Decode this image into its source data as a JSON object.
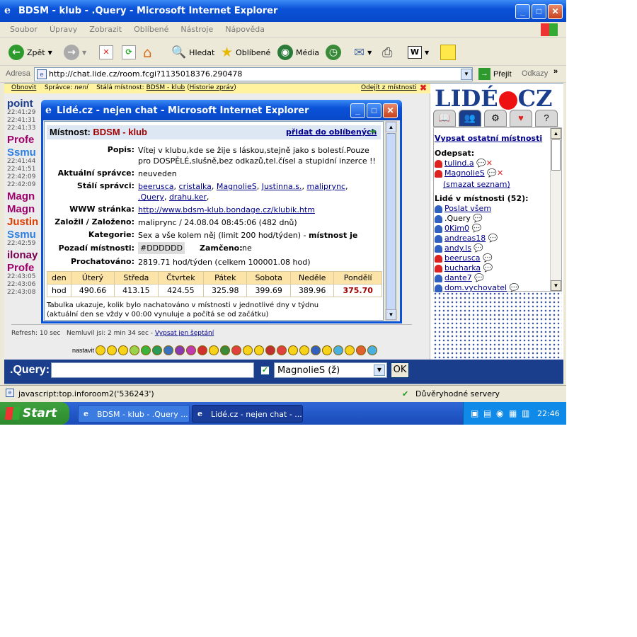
{
  "main_window": {
    "title": "BDSM - klub - .Query - Microsoft Internet Explorer",
    "menu": [
      "Soubor",
      "Úpravy",
      "Zobrazit",
      "Oblíbené",
      "Nástroje",
      "Nápověda"
    ],
    "toolbar": {
      "back": "Zpět",
      "search": "Hledat",
      "favorites": "Oblíbené",
      "media": "Média"
    },
    "address_label": "Adresa",
    "address_value": "http://chat.lide.cz/room.fcgi?1135018376.290478",
    "go_label": "Přejít",
    "links_label": "Odkazy"
  },
  "chat_toolbar": {
    "refresh": "Obnovit",
    "admin_label": "Správce:",
    "admin_value": "není",
    "permanent_label": "Stálá místnost:",
    "permanent_value": "BDSM - klub",
    "history": "Historie zpráv",
    "leave": "Odejít z místnosti"
  },
  "chat_lines": [
    {
      "nick": "point",
      "color": "#1a3d8c",
      "times": [
        "22:41:29",
        "22:41:31",
        "22:41:33"
      ]
    },
    {
      "nick": "Profe",
      "color": "#a0006a",
      "times": []
    },
    {
      "nick": "Ssmu",
      "color": "#2e7fe0",
      "times": [
        "22:41:44",
        "22:41:51",
        "22:42:09",
        "22:42:09"
      ]
    },
    {
      "nick": "Magn",
      "color": "#a0006a",
      "times": []
    },
    {
      "nick": "Magn",
      "color": "#a0006a",
      "times": []
    },
    {
      "nick": "Justin",
      "color": "#e04000",
      "times": []
    },
    {
      "nick": "Ssmu",
      "color": "#2e7fe0",
      "times": [
        "22:42:59"
      ]
    },
    {
      "nick": "ilonay",
      "color": "#7a0050",
      "times": []
    },
    {
      "nick": "Profe",
      "color": "#a0006a",
      "times": [
        "22:43:05",
        "22:43:06",
        "22:43:08"
      ]
    }
  ],
  "refresh_line": {
    "refresh": "Refresh: 10 sec",
    "idle": "Nemluvil jsi: 2 min 34 sec -",
    "whisper_link": "Vypsat jen šeptání"
  },
  "emoji_label": "nastavit",
  "input_bar": {
    "nick": ".Query:",
    "recipient": "MagnolieS (ž)",
    "ok": "OK"
  },
  "right_panel": {
    "list_rooms": "Vypsat ostatní místnosti",
    "reply_label": "Odepsat:",
    "reply_users": [
      "tulind.a",
      "MagnolieS"
    ],
    "clear_list": "(smazat seznam)",
    "people_label": "Lidé v místnosti (52):",
    "send_all": "Poslat všem",
    "users": [
      ".Query",
      "0Kim0",
      "andreas18",
      "andy.ls",
      "beerusca",
      "bucharka",
      "dante7",
      "dom.vychovatel"
    ]
  },
  "logo": {
    "left": "LIDÉ",
    "right": "CZ"
  },
  "popup": {
    "title": "Lidé.cz - nejen chat - Microsoft Internet Explorer",
    "room_label": "Místnost:",
    "room_name": "BDSM - klub",
    "add_fav": "přidat do oblíbených",
    "fields": {
      "theme_label": "Popis:",
      "theme_value": "Vítej v klubu,kde se žije s láskou,stejně jako s bolestí.Pouze pro DOSPĚLÉ,slušně,bez odkazů,tel.čísel a stupidní inzerce !!",
      "admin_label": "Aktuální správce:",
      "admin_value": "neuveden",
      "perm_admins_label": "Stálí správci:",
      "perm_admins": [
        "beerusca",
        "cristalka",
        "MagnolieS",
        "Justinna.s.",
        "maliprync",
        ".Query",
        "drahu.ker"
      ],
      "www_label": "WWW stránka:",
      "www_value": "http://www.bdsm-klub.bondage.cz/klubik.htm",
      "founded_label": "Založil / Založeno:",
      "founded_value": "maliprync / 24.08.04 08:45:06 (482 dnů)",
      "category_label": "Kategorie:",
      "category_value": "Sex a vše kolem něj (limit 200 hod/týden) -",
      "category_bold": "místnost je stálá",
      "bg_label": "Pozadí místnosti:",
      "bg_value": "#DDDDDD",
      "locked_label": "Zamčeno:",
      "locked_value": "ne",
      "chat_time_label": "Prochatováno:",
      "chat_time_value": "2819.71 hod/týden (celkem 100001.08 hod)"
    },
    "table": {
      "headers": [
        "den",
        "Úterý",
        "Středa",
        "Čtvrtek",
        "Pátek",
        "Sobota",
        "Neděle",
        "Pondělí"
      ],
      "row": [
        "hod",
        "490.66",
        "413.15",
        "424.55",
        "325.98",
        "399.69",
        "389.96",
        "375.70"
      ]
    },
    "note_line1": "Tabulka ukazuje, kolik bylo nachatováno v místnosti v jednotlivé dny v týdnu",
    "note_line2": "(aktuální den se vždy v 00:00 vynuluje a počítá se od začátku)"
  },
  "statusbar": {
    "left": "javascript:top.inforoom2('536243')",
    "right": "Důvěryhodné servery"
  },
  "taskbar": {
    "start": "Start",
    "items": [
      "BDSM - klub - .Query ...",
      "Lidé.cz - nejen chat - ..."
    ],
    "clock": "22:46"
  },
  "colors": {
    "accent_blue": "#0a52d8",
    "room_name": "#a00000",
    "today_value": "#a00000"
  }
}
